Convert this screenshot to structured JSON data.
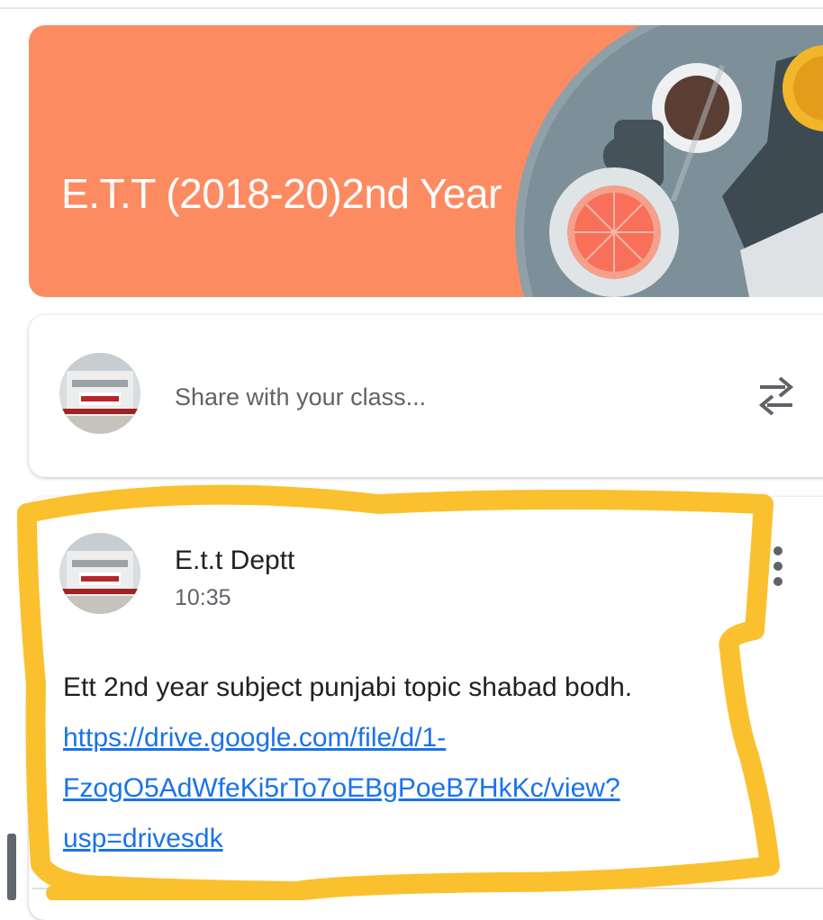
{
  "banner": {
    "class_title": "E.T.T (2018-20)2nd Year",
    "theme_color": "#fd8b62"
  },
  "share": {
    "placeholder": "Share with your class...",
    "icon": "repost-icon"
  },
  "post": {
    "author": "E.t.t Deptt",
    "time": "10:35",
    "text": "Ett 2nd year  subject punjabi   topic  shabad bodh.    ",
    "link": "https://drive.google.com/file/d/1-FzogO5AdWfeKi5rTo7oEBgPoeB7HkKc/view?usp=drivesdk",
    "menu_icon": "more-vert-icon"
  },
  "colors": {
    "link": "#1a73e8",
    "highlight": "#fbc02d"
  }
}
